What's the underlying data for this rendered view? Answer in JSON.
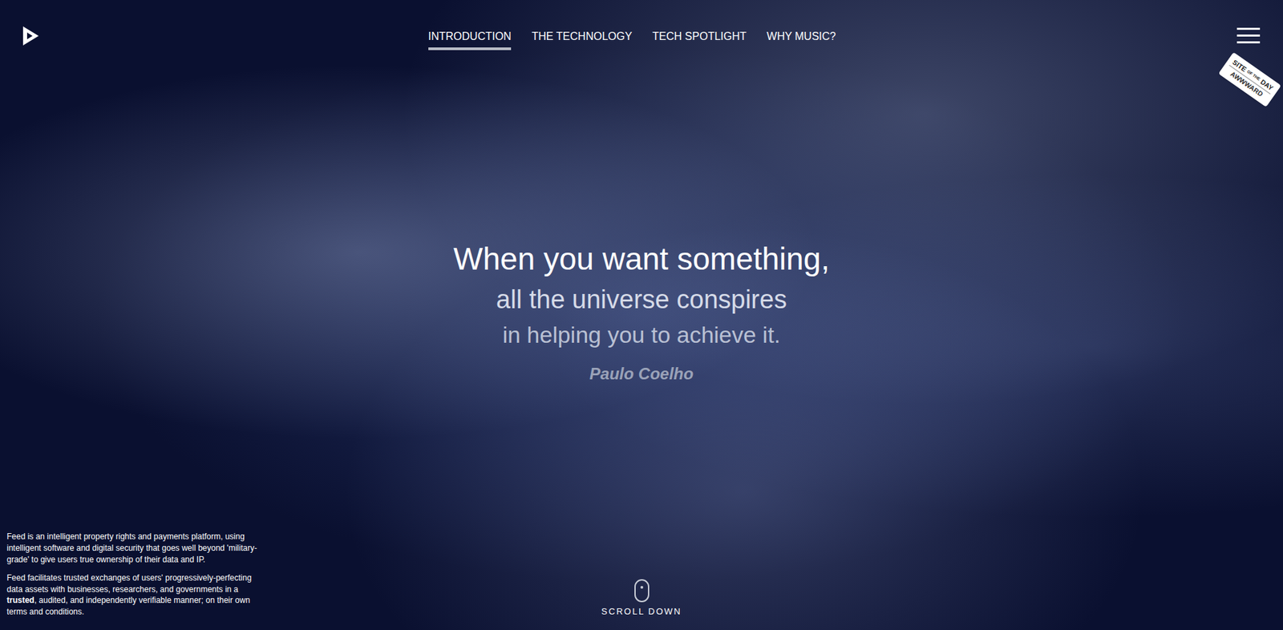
{
  "nav": [
    {
      "label": "INTRODUCTION",
      "selected": true
    },
    {
      "label": "THE TECHNOLOGY",
      "selected": false
    },
    {
      "label": "TECH SPOTLIGHT",
      "selected": false
    },
    {
      "label": "WHY MUSIC?",
      "selected": false
    }
  ],
  "badge": {
    "top": "SITE",
    "middle": "OF THE",
    "bottom": "DAY",
    "brand": "AWWWARD"
  },
  "quote": {
    "lines": [
      "When you want something,",
      "all the universe conspires",
      "in helping you to achieve it."
    ],
    "author": "Paulo Coelho"
  },
  "about": [
    [
      {
        "text": "Feed is an intelligent property rights and payments platform, using intelligent software and digital security that goes well beyond 'military-grade' to give users true ownership of their data and IP.",
        "bold": false
      }
    ],
    [
      {
        "text": "Feed facilitates trusted exchanges of users' progressively-perfecting data assets with businesses, researchers, and governments in a ",
        "bold": false
      },
      {
        "text": "trusted",
        "bold": true
      },
      {
        "text": ", audited, and independently verifiable manner; on their own terms and conditions.",
        "bold": false
      }
    ]
  ],
  "scroll": {
    "label": "SCROLL DOWN"
  }
}
